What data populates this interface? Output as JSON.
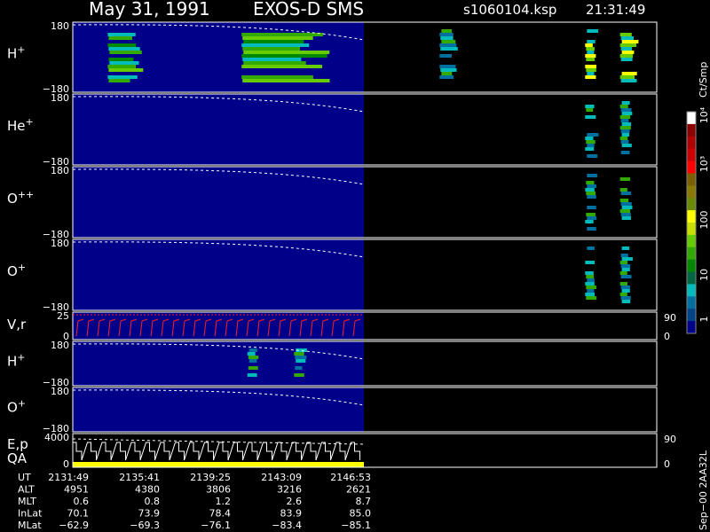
{
  "header": {
    "date": "May 31, 1991",
    "mission": "EXOS-D SMS",
    "file": "s1060104.ksp",
    "time": "21:31:49"
  },
  "colorbar": {
    "unit": "Ct/Smp",
    "ticks": [
      "10⁴",
      "10³",
      "100",
      "10",
      "1"
    ],
    "colors": [
      "#ffffff",
      "#8b0000",
      "#b00000",
      "#cc0000",
      "#ff0000",
      "#7a6000",
      "#8a7a00",
      "#6b8c00",
      "#ffff00",
      "#c8e000",
      "#66cc00",
      "#33aa00",
      "#008800",
      "#006644",
      "#00bbbb",
      "#0070a0",
      "#004488",
      "#000088"
    ]
  },
  "panels": [
    {
      "id": "h-plus",
      "label": "H",
      "sup": "+",
      "ymax": "180",
      "ymin": "−180"
    },
    {
      "id": "he-plus",
      "label": "He",
      "sup": "+",
      "ymax": "180",
      "ymin": "−180"
    },
    {
      "id": "o-plusplus",
      "label": "O",
      "sup": "++",
      "ymax": "180",
      "ymin": "−180"
    },
    {
      "id": "o-plus",
      "label": "O",
      "sup": "+",
      "ymax": "180",
      "ymin": "−180"
    },
    {
      "id": "vr",
      "label": "V,r",
      "sup": "",
      "ymax": "25",
      "ymin": "0",
      "right_top": "90",
      "right_bottom": "0"
    },
    {
      "id": "h-plus-2",
      "label": "H",
      "sup": "+",
      "ymax": "180",
      "ymin": "−180"
    },
    {
      "id": "o-plus-2",
      "label": "O",
      "sup": "+",
      "ymax": "180",
      "ymin": "−180"
    },
    {
      "id": "ep-qa",
      "label": "E,p",
      "label2": "QA",
      "sup": "",
      "ymax": "4000",
      "ymin": "0",
      "right_top": "90",
      "right_bottom": "0"
    }
  ],
  "footer": {
    "rows": [
      {
        "label": "UT",
        "values": [
          "2131:49",
          "2135:41",
          "2139:25",
          "2143:09",
          "2146:53"
        ]
      },
      {
        "label": "ALT",
        "values": [
          "4951",
          "4380",
          "3806",
          "3216",
          "2621"
        ]
      },
      {
        "label": "MLT",
        "values": [
          "0.6",
          "0.8",
          "1.2",
          "2.6",
          "8.7"
        ]
      },
      {
        "label": "InLat",
        "values": [
          "70.1",
          "73.9",
          "78.4",
          "83.9",
          "85.0"
        ]
      },
      {
        "label": "MLat",
        "values": [
          "−62.9",
          "−69.3",
          "−76.1",
          "−83.4",
          "−85.1"
        ]
      }
    ],
    "side_note": "Sep−00 2AA32L"
  },
  "chart_data": {
    "type": "heatmap",
    "title": "May 31, 1991   EXOS-D SMS   s1060104.ksp  21:31:49",
    "xlabel": "UT",
    "x_ticks": [
      "2131:49",
      "2135:41",
      "2139:25",
      "2143:09",
      "2146:53"
    ],
    "colorbar_label": "Ct/Smp",
    "colorbar_range": [
      1,
      10000
    ],
    "colorbar_scale": "log",
    "data_coverage_fraction": 0.5,
    "panels": [
      {
        "species": "H+",
        "ylim": [
          -180,
          180
        ],
        "intensity_bands": [
          {
            "x": [
              0.06,
              0.12
            ],
            "level": "high"
          },
          {
            "x": [
              0.29,
              0.45
            ],
            "level": "high"
          },
          {
            "x": [
              0.63,
              0.66
            ],
            "level": "medium"
          },
          {
            "x": [
              0.88,
              0.9
            ],
            "level": "very-high"
          },
          {
            "x": [
              0.94,
              0.97
            ],
            "level": "very-high"
          }
        ]
      },
      {
        "species": "He+",
        "ylim": [
          -180,
          180
        ],
        "intensity_bands": [
          {
            "x": [
              0.88,
              0.9
            ],
            "level": "medium"
          },
          {
            "x": [
              0.94,
              0.96
            ],
            "level": "medium"
          }
        ]
      },
      {
        "species": "O++",
        "ylim": [
          -180,
          180
        ],
        "intensity_bands": [
          {
            "x": [
              0.88,
              0.9
            ],
            "level": "medium"
          },
          {
            "x": [
              0.94,
              0.96
            ],
            "level": "medium"
          }
        ]
      },
      {
        "species": "O+",
        "ylim": [
          -180,
          180
        ],
        "intensity_bands": [
          {
            "x": [
              0.88,
              0.9
            ],
            "level": "medium"
          },
          {
            "x": [
              0.94,
              0.96
            ],
            "level": "medium"
          }
        ]
      },
      {
        "species": "V,r",
        "ylim": [
          0,
          25
        ],
        "right_ylim": [
          0,
          90
        ],
        "note": "repeating sawtooth sweep"
      },
      {
        "species": "H+",
        "ylim": [
          -180,
          180
        ],
        "intensity_bands": [
          {
            "x": [
              0.3,
              0.32
            ],
            "level": "medium"
          },
          {
            "x": [
              0.38,
              0.4
            ],
            "level": "medium"
          }
        ]
      },
      {
        "species": "O+",
        "ylim": [
          -180,
          180
        ],
        "intensity_bands": []
      },
      {
        "species": "E,p / QA",
        "ylim": [
          0,
          4000
        ],
        "right_ylim": [
          0,
          90
        ],
        "note": "staircase energy sweep with QA bar"
      }
    ]
  }
}
